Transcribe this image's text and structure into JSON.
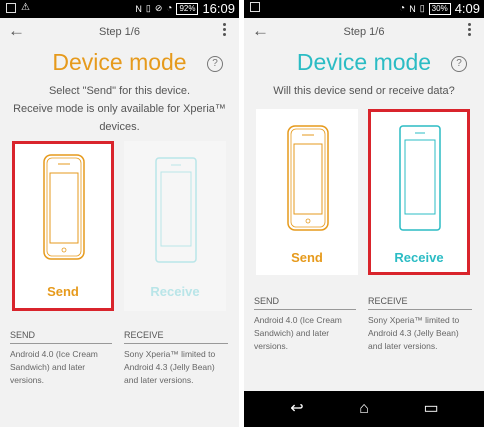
{
  "colors": {
    "send": "#e69a1c",
    "receive": "#2bbcc4",
    "highlight": "#d9242c"
  },
  "left": {
    "status": {
      "icons": [
        "image-icon",
        "warning-icon",
        "nfc-icon",
        "vibrate-icon",
        "mute-icon",
        "wifi-icon"
      ],
      "battery": "92%",
      "time": "16:09"
    },
    "step": "Step 1/6",
    "title": "Device mode",
    "description_lines": [
      "Select \"Send\" for this device.",
      "Receive mode is only available for Xperia™",
      "devices."
    ],
    "send_label": "Send",
    "receive_label": "Receive",
    "send_heading": "SEND",
    "send_text": "Android 4.0 (Ice Cream Sandwich) and later versions.",
    "receive_heading": "RECEIVE",
    "receive_text": "Sony Xperia™ limited to Android 4.3 (Jelly Bean) and later versions."
  },
  "right": {
    "status": {
      "icons": [
        "image-icon",
        "wifi-icon",
        "nfc-icon",
        "vibrate-icon"
      ],
      "battery": "30%",
      "time": "4:09"
    },
    "step": "Step 1/6",
    "title": "Device mode",
    "description": "Will this device send or receive data?",
    "send_label": "Send",
    "receive_label": "Receive",
    "send_heading": "SEND",
    "send_text": "Android 4.0 (Ice Cream Sandwich) and later versions.",
    "receive_heading": "RECEIVE",
    "receive_text": "Sony Xperia™ limited to Android 4.3 (Jelly Bean) and later versions.",
    "nav": [
      "back-icon",
      "home-icon",
      "recent-apps-icon"
    ]
  }
}
